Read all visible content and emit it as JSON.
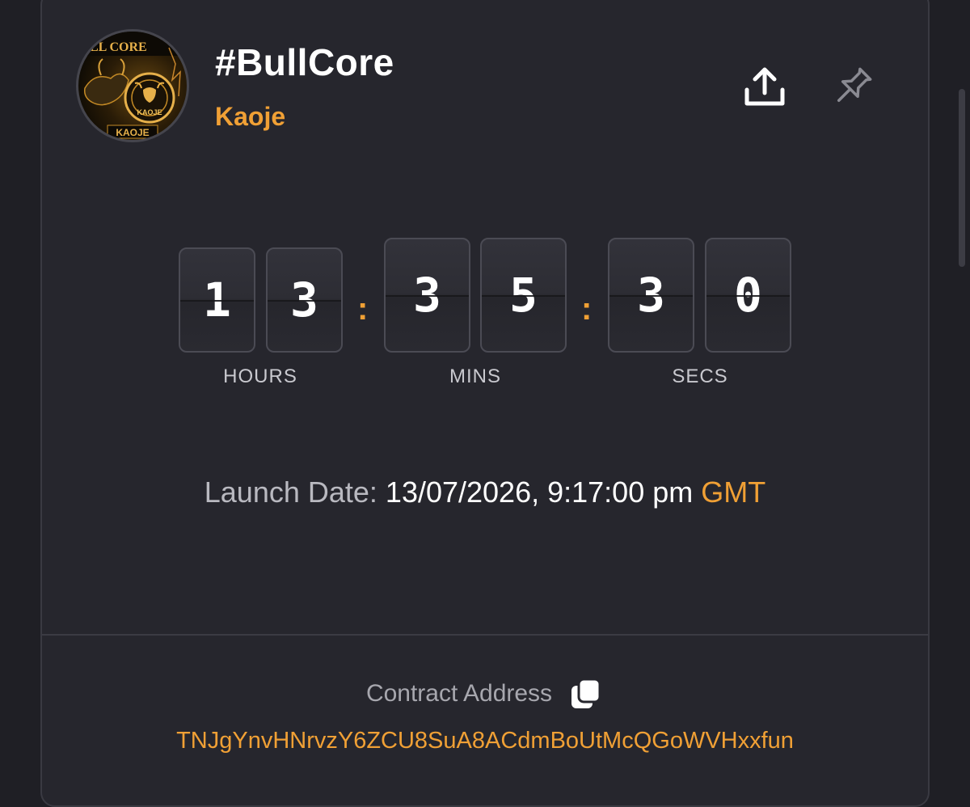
{
  "token": {
    "name": "#BullCore",
    "creator": "Kaoje"
  },
  "avatar": {
    "banner_text": "LL CORE",
    "coin_text": "KAOJE",
    "footer_text": "KAOJE"
  },
  "countdown": {
    "hours": [
      "1",
      "3"
    ],
    "mins": [
      "3",
      "5"
    ],
    "secs": [
      "3",
      "0"
    ],
    "separator": ":",
    "labels": {
      "hours": "HOURS",
      "mins": "MINS",
      "secs": "SECS"
    }
  },
  "launch": {
    "label": "Launch Date:",
    "value": "13/07/2026, 9:17:00 pm",
    "timezone": "GMT"
  },
  "contract": {
    "label": "Contract Address",
    "address": "TNJgYnvHNrvzY6ZCU8SuA8ACdmBoUtMcQGoWVHxxfun"
  },
  "icons": {
    "share": "share-upload-icon",
    "pin": "pin-icon",
    "copy": "copy-icon"
  },
  "colors": {
    "accent": "#f0a035",
    "background": "#26262d",
    "text": "#ffffff",
    "muted": "#b9b9c0"
  }
}
